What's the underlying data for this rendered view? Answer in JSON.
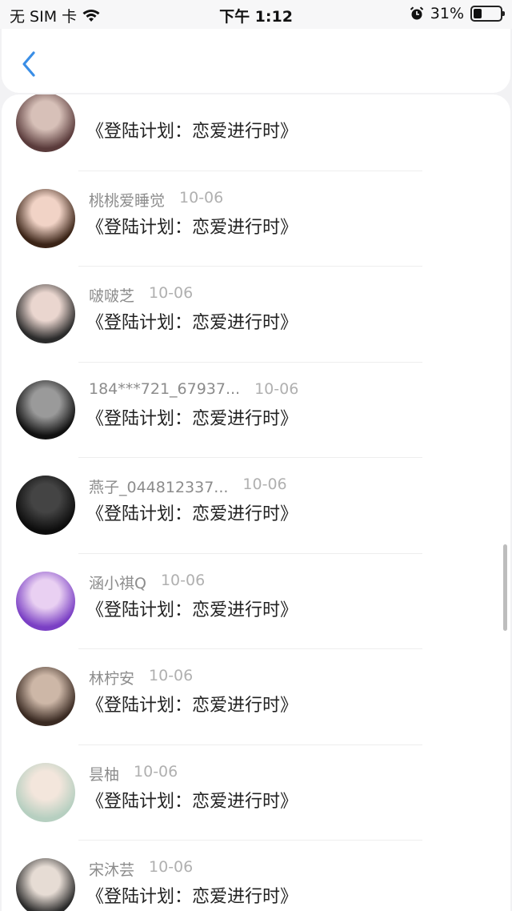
{
  "status_bar": {
    "carrier": "无 SIM 卡",
    "time": "下午 1:12",
    "battery_percent": "31%",
    "battery_level": 0.31
  },
  "header": {
    "back_icon": "chevron-left-icon"
  },
  "items": [
    {
      "name": "",
      "date": "",
      "message": "《登陆计划：恋爱进行时》",
      "avatar": [
        "#5a3b3b",
        "#d7c0b8"
      ]
    },
    {
      "name": "桃桃爱睡觉",
      "date": "10-06",
      "message": "《登陆计划：恋爱进行时》",
      "avatar": [
        "#3b2417",
        "#f1d3c6"
      ]
    },
    {
      "name": "啵啵芝",
      "date": "10-06",
      "message": "《登陆计划：恋爱进行时》",
      "avatar": [
        "#2b2b2b",
        "#ead6cf"
      ]
    },
    {
      "name": "184***721_67937...",
      "date": "10-06",
      "message": "《登陆计划：恋爱进行时》",
      "avatar": [
        "#111111",
        "#9a9a9a"
      ]
    },
    {
      "name": "燕子_044812337...",
      "date": "10-06",
      "message": "《登陆计划：恋爱进行时》",
      "avatar": [
        "#0d0d0d",
        "#444444"
      ]
    },
    {
      "name": "涵小祺Q",
      "date": "10-06",
      "message": "《登陆计划：恋爱进行时》",
      "avatar": [
        "#7a3fc4",
        "#e9d0f2"
      ]
    },
    {
      "name": "林柠安",
      "date": "10-06",
      "message": "《登陆计划：恋爱进行时》",
      "avatar": [
        "#3a2a22",
        "#cdb7a7"
      ]
    },
    {
      "name": "昙柚",
      "date": "10-06",
      "message": "《登陆计划：恋爱进行时》",
      "avatar": [
        "#b6cfc0",
        "#f3e6dc"
      ]
    },
    {
      "name": "宋沐芸",
      "date": "10-06",
      "message": "《登陆计划：恋爱进行时》",
      "avatar": [
        "#2a2a2a",
        "#e6dcd4"
      ]
    }
  ]
}
